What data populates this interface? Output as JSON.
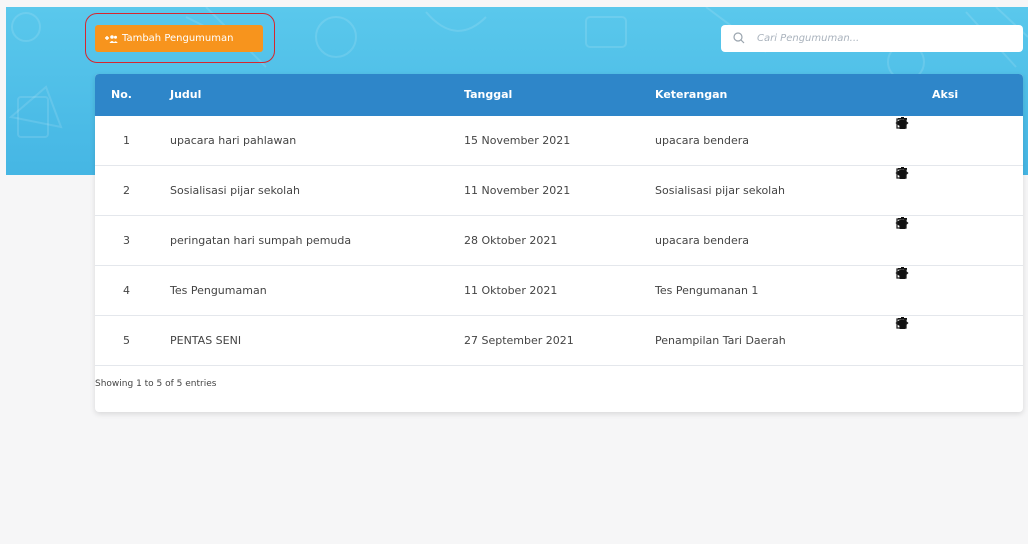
{
  "toolbar": {
    "add_label": "Tambah Pengumuman"
  },
  "search": {
    "placeholder": "Cari Pengumuman..."
  },
  "table": {
    "headers": {
      "no": "No.",
      "judul": "Judul",
      "tanggal": "Tanggal",
      "keterangan": "Keterangan",
      "aksi": "Aksi"
    },
    "rows": [
      {
        "no": "1",
        "judul": "upacara hari pahlawan",
        "tanggal": "15 November 2021",
        "keterangan": "upacara bendera"
      },
      {
        "no": "2",
        "judul": "Sosialisasi pijar sekolah",
        "tanggal": "11 November 2021",
        "keterangan": "Sosialisasi pijar sekolah"
      },
      {
        "no": "3",
        "judul": "peringatan hari sumpah pemuda",
        "tanggal": "28 Oktober 2021",
        "keterangan": "upacara bendera"
      },
      {
        "no": "4",
        "judul": "Tes Pengumaman",
        "tanggal": "11 Oktober 2021",
        "keterangan": "Tes Pengumanan 1"
      },
      {
        "no": "5",
        "judul": "PENTAS SENI",
        "tanggal": "27 September 2021",
        "keterangan": "Penampilan Tari Daerah"
      }
    ],
    "footer": "Showing 1 to 5 of 5 entries"
  },
  "colors": {
    "header_bg": "#2e86c9",
    "hero_bg": "#4fc0ea",
    "button_bg": "#f7941d",
    "highlight": "#d6262e"
  },
  "icons": {
    "add": "add-users-icon",
    "search": "search-icon",
    "view": "eye-icon",
    "edit": "edit-icon",
    "delete": "trash-icon"
  }
}
